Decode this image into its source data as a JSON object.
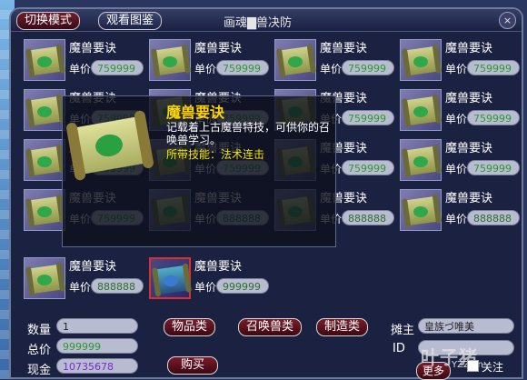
{
  "window": {
    "title": "画魂▇兽决防",
    "mode_button": "切换模式",
    "view_button": "观看图鉴",
    "close": "×"
  },
  "slots": [
    {
      "name": "魔兽要诀",
      "price_label": "单价",
      "price": "759999"
    },
    {
      "name": "魔兽要诀",
      "price_label": "单价",
      "price": "759999"
    },
    {
      "name": "魔兽要诀",
      "price_label": "单价",
      "price": "759999"
    },
    {
      "name": "魔兽要诀",
      "price_label": "单价",
      "price": "759999"
    },
    {
      "name": "魔兽要诀",
      "price_label": "单价",
      "price": "759999"
    },
    {
      "name": "魔兽要诀",
      "price_label": "单价",
      "price": "759999"
    },
    {
      "name": "魔兽要诀",
      "price_label": "单价",
      "price": "759999"
    },
    {
      "name": "魔兽要诀",
      "price_label": "单价",
      "price": "759999"
    },
    {
      "name": "魔兽要诀",
      "price_label": "单价",
      "price": "759999"
    },
    {
      "name": "魔兽要诀",
      "price_label": "单价",
      "price": "759999"
    },
    {
      "name": "魔兽要诀",
      "price_label": "单价",
      "price": "759999"
    },
    {
      "name": "魔兽要诀",
      "price_label": "单价",
      "price": "759999"
    },
    {
      "name": "魔兽要诀",
      "price_label": "单价",
      "price": "759999"
    },
    {
      "name": "魔兽要诀",
      "price_label": "单价",
      "price": "888888"
    },
    {
      "name": "魔兽要诀",
      "price_label": "单价",
      "price": "888888"
    },
    {
      "name": "魔兽要诀",
      "price_label": "单价",
      "price": "888888"
    },
    {
      "name": "魔兽要诀",
      "price_label": "单价",
      "price": "888888"
    },
    {
      "name": "魔兽要诀",
      "price_label": "单价",
      "price": "999999"
    }
  ],
  "tooltip": {
    "title": "魔兽要诀",
    "description": "记载着上古魔兽特技，可供你的召唤兽学习。",
    "skill_line": "所带技能：法术连击"
  },
  "bottom": {
    "qty_label": "数量",
    "qty": "1",
    "total_label": "总价",
    "total": "999999",
    "cash_label": "现金",
    "cash": "10735678",
    "tab_items": "物品类",
    "tab_pets": "召唤兽类",
    "tab_craft": "制造类",
    "buy": "购买",
    "vendor_label": "摊主",
    "vendor": "皇族づ唯美",
    "id_label": "ID",
    "more": "更多",
    "follow": "关注"
  },
  "watermark": {
    "main": "叶子猪",
    "sub": "YZZ.cn"
  },
  "colors": {
    "price_green": "#2c9a2c",
    "title_yellow": "#ffd400",
    "skill_yellow": "#f2e600"
  }
}
